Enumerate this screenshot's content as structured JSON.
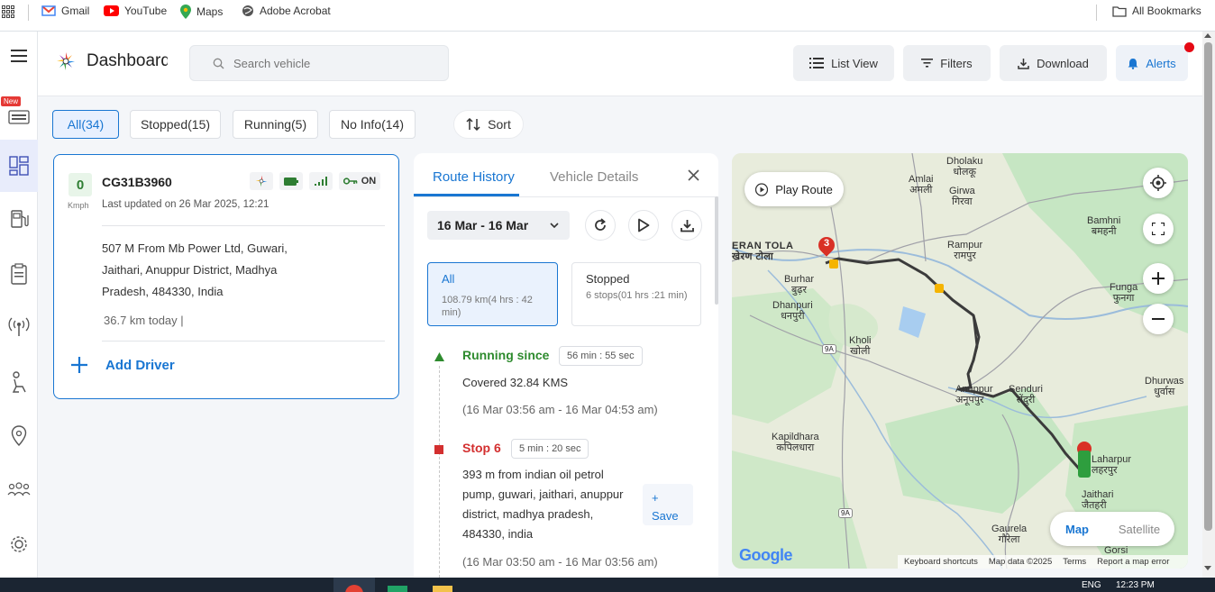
{
  "bookmarks": {
    "items": [
      {
        "label": "Gmail",
        "icon": "gmail-icon",
        "color": "#ea4335"
      },
      {
        "label": "YouTube",
        "icon": "youtube-icon",
        "color": "#ff0000"
      },
      {
        "label": "Maps",
        "icon": "maps-icon",
        "color": "#34a853"
      },
      {
        "label": "Adobe Acrobat",
        "icon": "adobe-acrobat-icon",
        "color": "#555555"
      }
    ],
    "all_bookmarks": "All Bookmarks"
  },
  "sidebar": {
    "new_badge": "New"
  },
  "header": {
    "title": "Dashboard",
    "search_placeholder": "Search vehicle",
    "list_view": "List View",
    "filters": "Filters",
    "download": "Download",
    "alerts": "Alerts"
  },
  "filters": {
    "all": "All(34)",
    "stopped": "Stopped(15)",
    "running": "Running(5)",
    "no_info": "No Info(14)",
    "sort": "Sort"
  },
  "vehicle": {
    "speed": "0",
    "speed_unit": "Kmph",
    "plate": "CG31B3960",
    "ignition": "ON",
    "last_updated": "Last updated on 26 Mar 2025, 12:21",
    "address": "507 M From Mb Power Ltd, Guwari, Jaithari, Anuppur District, Madhya Pradesh, 484330, India",
    "distance_today": "36.7 km today |",
    "add_driver": "Add Driver"
  },
  "route_panel": {
    "tab_route_history": "Route History",
    "tab_vehicle_details": "Vehicle Details",
    "date_range": "16 Mar - 16 Mar",
    "all": {
      "title": "All",
      "detail": "108.79 km(4 hrs : 42 min)"
    },
    "stopped": {
      "title": "Stopped",
      "detail": "6 stops(01 hrs :21 min)"
    },
    "running": {
      "title": "Running since",
      "duration": "56 min : 55 sec",
      "covered": "Covered 32.84 KMS",
      "time": "(16 Mar 03:56 am - 16 Mar 04:53 am)"
    },
    "stop6": {
      "title": "Stop 6",
      "duration": "5 min : 20 sec",
      "address": "393 m from indian oil petrol pump, guwari, jaithari, anuppur district, madhya pradesh, 484330, india",
      "save_plus": "+",
      "save": "Save",
      "time": "(16 Mar 03:50 am - 16 Mar 03:56 am)"
    }
  },
  "map": {
    "play_route": "Play Route",
    "marker_number": "3",
    "labels": [
      {
        "t": "Dholaku",
        "h": "धोलकू"
      },
      {
        "t": "Amlai",
        "h": "अमली"
      },
      {
        "t": "Girwa",
        "h": "गिरवा"
      },
      {
        "t": "Bamhni",
        "h": "बमहनी"
      },
      {
        "t": "ERAN TOLA",
        "h": "खेरण टोला"
      },
      {
        "t": "Rampur",
        "h": "रामपुर"
      },
      {
        "t": "Burhar",
        "h": "बुढ़र"
      },
      {
        "t": "Funga",
        "h": "फुनगा"
      },
      {
        "t": "Dhanpuri",
        "h": "धनपुरी"
      },
      {
        "t": "Kholi",
        "h": "खोली"
      },
      {
        "t": "Dhurwas",
        "h": "धुर्वास"
      },
      {
        "t": "Senduri",
        "h": "सेंदुरी"
      },
      {
        "t": "Anuppur",
        "h": "अनूपपुर"
      },
      {
        "t": "Kapildhara",
        "h": "कपिलधारा"
      },
      {
        "t": "Laharpur",
        "h": "लहरपुर"
      },
      {
        "t": "Jaithari",
        "h": "जैतहरी"
      },
      {
        "t": "Gaurela",
        "h": "गौरेला"
      },
      {
        "t": "Gorsi",
        "h": ""
      }
    ],
    "road_badges": [
      "9A",
      "9A",
      "9A"
    ],
    "type_map": "Map",
    "type_satellite": "Satellite",
    "google": "Google",
    "footer": [
      "Keyboard shortcuts",
      "Map data ©2025",
      "Terms",
      "Report a map error"
    ]
  },
  "taskbar": {
    "lang": "ENG",
    "time": "12:23 PM"
  }
}
